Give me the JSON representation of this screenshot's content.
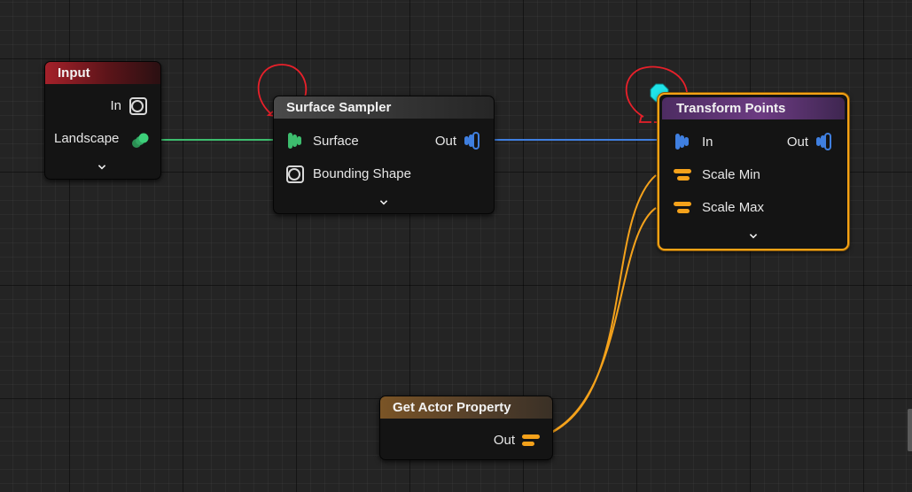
{
  "nodes": {
    "input": {
      "title": "Input",
      "pins": {
        "in": "In",
        "landscape": "Landscape"
      }
    },
    "surface_sampler": {
      "title": "Surface Sampler",
      "pins": {
        "surface": "Surface",
        "bounding_shape": "Bounding Shape",
        "out": "Out"
      }
    },
    "transform_points": {
      "title": "Transform Points",
      "pins": {
        "in": "In",
        "scale_min": "Scale Min",
        "scale_max": "Scale Max",
        "out": "Out"
      }
    },
    "get_actor_property": {
      "title": "Get Actor Property",
      "pins": {
        "out": "Out"
      }
    }
  },
  "colors": {
    "spatial_wire": "#3f7fe0",
    "landscape_wire": "#3dbd6e",
    "attribute_wire": "#f5a21b",
    "selection": "#f5a215",
    "annotation": "#e8202a",
    "reroute_dot": "#1fe3e8"
  },
  "icons": [
    "node-input-pin-icon",
    "landscape-pin-icon",
    "surface-pin-icon",
    "bounding-shape-pin-icon",
    "spatial-out-pin-icon",
    "attribute-pin-icon",
    "chevron-down-icon",
    "reroute-dot-icon"
  ]
}
